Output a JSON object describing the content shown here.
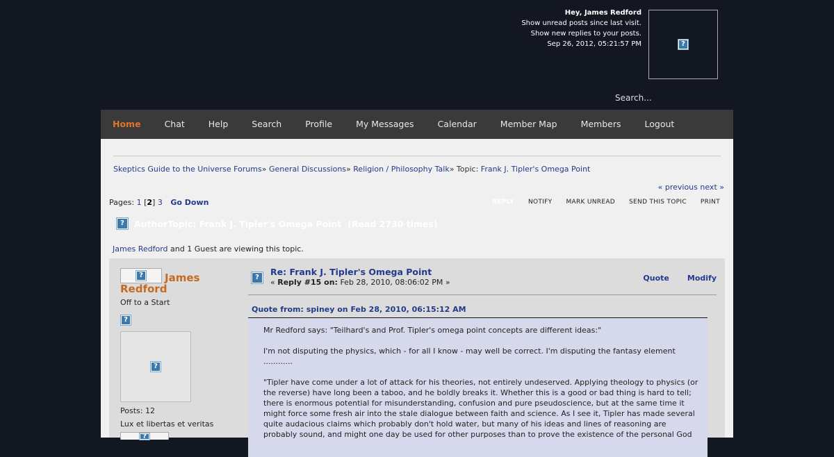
{
  "user": {
    "greeting": "Hey, James Redford",
    "unread": "Show unread posts since last visit.",
    "replies": "Show new replies to your posts.",
    "datetime": "Sep 26, 2012, 05:21:57 PM"
  },
  "search": {
    "placeholder": "Search..."
  },
  "nav": {
    "items": [
      "Home",
      "Chat",
      "Help",
      "Search",
      "Profile",
      "My Messages",
      "Calendar",
      "Member Map",
      "Members",
      "Logout"
    ]
  },
  "breadcrumb": {
    "c0": "Skeptics Guide to the Universe Forums",
    "sep": "»",
    "c1": "General Discussions",
    "c2": "Religion / Philosophy Talk",
    "c3_prefix": "Topic:",
    "c3": "Frank J. Tipler's Omega Point"
  },
  "prevnext": {
    "prev": "« previous",
    "next": "next »"
  },
  "pages": {
    "label": "Pages:",
    "p1": "1",
    "current": "2",
    "p3": "3",
    "go_down": "Go Down"
  },
  "topic_buttons": {
    "reply": "REPLY",
    "notify": "NOTIFY",
    "mark_unread": "MARK UNREAD",
    "send": "SEND THIS TOPIC",
    "print": "PRINT"
  },
  "topic_title": "AuthorTopic: Frank J. Tipler's Omega Point  (Read 2730 times)",
  "viewers": {
    "user": "James Redford",
    "rest": " and 1 Guest are viewing this topic."
  },
  "poster": {
    "name": "James Redford",
    "title": "Off to a Start",
    "posts": "Posts: 12",
    "motto": "Lux et libertas et veritas"
  },
  "post": {
    "subject": "Re: Frank J. Tipler's Omega Point",
    "reply_label": "Reply #15 on:",
    "date": "Feb 28, 2010, 08:06:02 PM",
    "quote_btn": "Quote",
    "modify_btn": "Modify",
    "quote_header": "Quote from: spiney on Feb 28, 2010, 06:15:12 AM",
    "quote_p1": "Mr Redford says: \"Teilhard's and Prof. Tipler's omega point concepts are different ideas:\"",
    "quote_p2": "I'm not disputing the physics, which - for all I know - may well be correct. I'm disputing the fantasy element ............",
    "quote_p3": "\"Tipler have come under a lot of attack for his theories, not entirely undeserved. Applying theology to physics (or the reverse) have long been a taboo, and he boldly breaks it. Whether this is a good or bad thing is hard to tell; there is enormous potential for misunderstanding, confusion and pure pseudoscience, but at the same time it might force some fresh air into the stale dialogue between faith and science. As I see it, Tipler has made several quite audacious claims which probably don't hold water, but many of his ideas and lines of reasoning are probably sound, and might one day be used for other purposes than to prove the existence of the personal God"
  }
}
